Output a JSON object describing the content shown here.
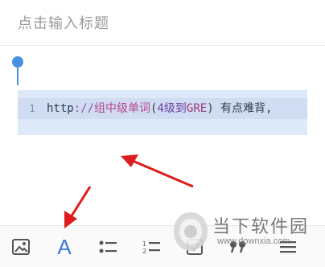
{
  "editor": {
    "title_placeholder": "点击输入标题",
    "code": {
      "line_number": "1",
      "tokens": [
        "http",
        "://",
        "组中级单词",
        "(",
        "4级到",
        "GRE",
        ")",
        " 有点难背,"
      ]
    }
  },
  "toolbar": {
    "items": [
      {
        "icon": "image-icon"
      },
      {
        "icon": "font-icon",
        "label": "A"
      },
      {
        "icon": "bulleted-list-icon"
      },
      {
        "icon": "numbered-list-icon"
      },
      {
        "icon": "checkbox-icon"
      },
      {
        "icon": "quote-icon"
      },
      {
        "icon": "menu-icon"
      }
    ]
  },
  "watermark": {
    "name": "当下软件园",
    "url": "www.downxia.com"
  },
  "colors": {
    "accent": "#3d7ce0",
    "annotation_arrow": "#e01c1c",
    "code_highlight": "#cfdcf2"
  }
}
